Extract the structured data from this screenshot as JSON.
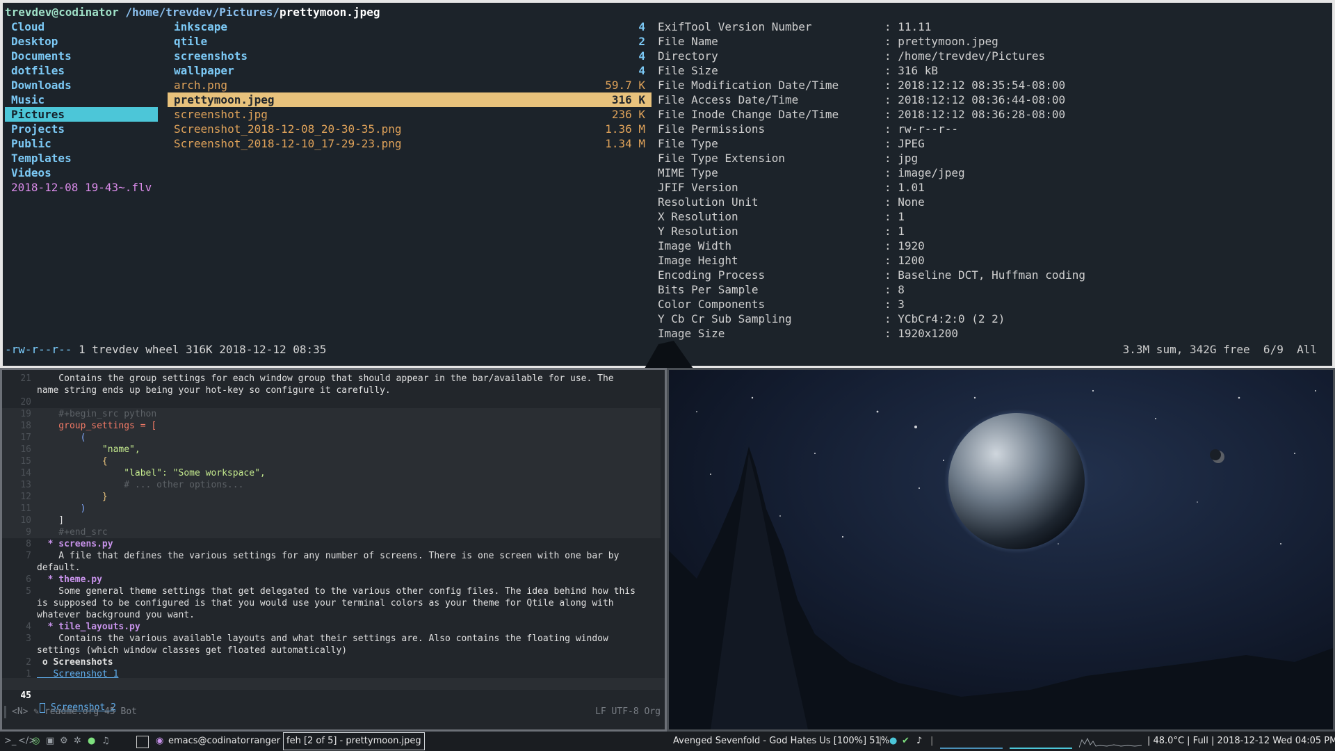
{
  "ranger": {
    "path": {
      "user": "trevdev@codinator",
      "dir": "/home/trevdev/Pictures/",
      "file": "prettymoon.jpeg"
    },
    "parent_dirs": [
      {
        "name": "Cloud"
      },
      {
        "name": "Desktop"
      },
      {
        "name": "Documents"
      },
      {
        "name": "dotfiles"
      },
      {
        "name": "Downloads"
      },
      {
        "name": "Music"
      },
      {
        "name": "Pictures",
        "selected": true
      },
      {
        "name": "Projects"
      },
      {
        "name": "Public"
      },
      {
        "name": "Templates"
      },
      {
        "name": "Videos"
      },
      {
        "name": "2018-12-08 19-43~.flv",
        "kind": "video"
      }
    ],
    "files": [
      {
        "name": "inkscape",
        "size": "4",
        "kind": "dir"
      },
      {
        "name": "qtile",
        "size": "2",
        "kind": "dir"
      },
      {
        "name": "screenshots",
        "size": "4",
        "kind": "dir"
      },
      {
        "name": "wallpaper",
        "size": "4",
        "kind": "dir"
      },
      {
        "name": "arch.png",
        "size": "59.7 K",
        "kind": "img"
      },
      {
        "name": "prettymoon.jpeg",
        "size": "316 K",
        "kind": "img",
        "selected": true
      },
      {
        "name": "screenshot.jpg",
        "size": "236 K",
        "kind": "img"
      },
      {
        "name": "Screenshot_2018-12-08_20-30-35.png",
        "size": "1.36 M",
        "kind": "img"
      },
      {
        "name": "Screenshot_2018-12-10_17-29-23.png",
        "size": "1.34 M",
        "kind": "img"
      }
    ],
    "exif": [
      {
        "k": "ExifTool Version Number",
        "v": ": 11.11"
      },
      {
        "k": "File Name",
        "v": ": prettymoon.jpeg"
      },
      {
        "k": "Directory",
        "v": ": /home/trevdev/Pictures"
      },
      {
        "k": "File Size",
        "v": ": 316 kB"
      },
      {
        "k": "File Modification Date/Time",
        "v": ": 2018:12:12 08:35:54-08:00"
      },
      {
        "k": "File Access Date/Time",
        "v": ": 2018:12:12 08:36:44-08:00"
      },
      {
        "k": "File Inode Change Date/Time",
        "v": ": 2018:12:12 08:36:28-08:00"
      },
      {
        "k": "File Permissions",
        "v": ": rw-r--r--"
      },
      {
        "k": "File Type",
        "v": ": JPEG"
      },
      {
        "k": "File Type Extension",
        "v": ": jpg"
      },
      {
        "k": "MIME Type",
        "v": ": image/jpeg"
      },
      {
        "k": "JFIF Version",
        "v": ": 1.01"
      },
      {
        "k": "Resolution Unit",
        "v": ": None"
      },
      {
        "k": "X Resolution",
        "v": ": 1"
      },
      {
        "k": "Y Resolution",
        "v": ": 1"
      },
      {
        "k": "Image Width",
        "v": ": 1920"
      },
      {
        "k": "Image Height",
        "v": ": 1200"
      },
      {
        "k": "Encoding Process",
        "v": ": Baseline DCT, Huffman coding"
      },
      {
        "k": "Bits Per Sample",
        "v": ": 8"
      },
      {
        "k": "Color Components",
        "v": ": 3"
      },
      {
        "k": "Y Cb Cr Sub Sampling",
        "v": ": YCbCr4:2:0 (2 2)"
      },
      {
        "k": "Image Size",
        "v": ": 1920x1200"
      }
    ],
    "status": {
      "perms": "-rw-r--r--",
      "info": " 1 trevdev wheel 316K 2018-12-12 08:35",
      "right": "3.3M sum, 342G free  6/9  All"
    }
  },
  "emacs": {
    "lines": [
      {
        "n": "21",
        "cls": "",
        "t": "    Contains the group settings for each window group that should appear in the bar/available for use. The"
      },
      {
        "n": "",
        "cls": "",
        "t": "name string ends up being your hot-key so configure it carefully."
      },
      {
        "n": "20",
        "cls": "",
        "t": ""
      },
      {
        "n": "19",
        "cls": "code c-com",
        "t": "    #+begin_src python"
      },
      {
        "n": "18",
        "cls": "code",
        "t": "    group_settings = [",
        "kind": "var"
      },
      {
        "n": "17",
        "cls": "code c-paren",
        "t": "        ("
      },
      {
        "n": "16",
        "cls": "code c-str",
        "t": "            \"name\","
      },
      {
        "n": "15",
        "cls": "code c-brace",
        "t": "            {"
      },
      {
        "n": "14",
        "cls": "code c-str",
        "t": "                \"label\": \"Some workspace\","
      },
      {
        "n": "13",
        "cls": "code c-com",
        "t": "                # ... other options..."
      },
      {
        "n": "12",
        "cls": "code c-brace",
        "t": "            }"
      },
      {
        "n": "11",
        "cls": "code c-paren",
        "t": "        )"
      },
      {
        "n": "10",
        "cls": "code",
        "t": "    ]"
      },
      {
        "n": "9",
        "cls": "code c-com",
        "t": "    #+end_src"
      },
      {
        "n": "8",
        "cls": "c-head",
        "t": "  * screens.py"
      },
      {
        "n": "7",
        "cls": "",
        "t": "    A file that defines the various settings for any number of screens. There is one screen with one bar by"
      },
      {
        "n": "",
        "cls": "",
        "t": "default."
      },
      {
        "n": "6",
        "cls": "c-head",
        "t": "  * theme.py"
      },
      {
        "n": "5",
        "cls": "",
        "t": "    Some general theme settings that get delegated to the various other config files. The idea behind how this"
      },
      {
        "n": "",
        "cls": "",
        "t": "is supposed to be configured is that you would use your terminal colors as your theme for Qtile along with"
      },
      {
        "n": "",
        "cls": "",
        "t": "whatever background you want."
      },
      {
        "n": "4",
        "cls": "c-head",
        "t": "  * tile_layouts.py"
      },
      {
        "n": "3",
        "cls": "",
        "t": "    Contains the various available layouts and what their settings are. Also contains the floating window"
      },
      {
        "n": "",
        "cls": "",
        "t": "settings (which window classes get floated automatically)"
      },
      {
        "n": "2",
        "cls": "c-head2",
        "t": " o Screenshots"
      },
      {
        "n": "1",
        "cls": "c-link",
        "t": "   Screenshot 1"
      }
    ],
    "current_line": {
      "n": "45",
      "t": "Screenshot 2"
    },
    "modeline": {
      "left": "<N>  ✎ readme.org 45 Bot",
      "right": "LF UTF-8  Org"
    }
  },
  "bar": {
    "left_icons": [
      "terminal-icon",
      "code-icon",
      "browser-icon",
      "image-icon",
      "settings-icon",
      "gear-icon",
      "chat-icon",
      "music-icon"
    ],
    "windows": [
      "emacs@codinator",
      "ranger",
      "feh [2 of 5] - prettymoon.jpeg"
    ],
    "music": "Avenged Sevenfold - God Hates Us [100%] 51%",
    "right": "| 48.0°C | Full | 2018-12-12 Wed 04:05 PM"
  },
  "colors": {
    "accent": "#4cc6d8",
    "selection": "#e8c27c",
    "border_active": "#e6e6e6"
  }
}
